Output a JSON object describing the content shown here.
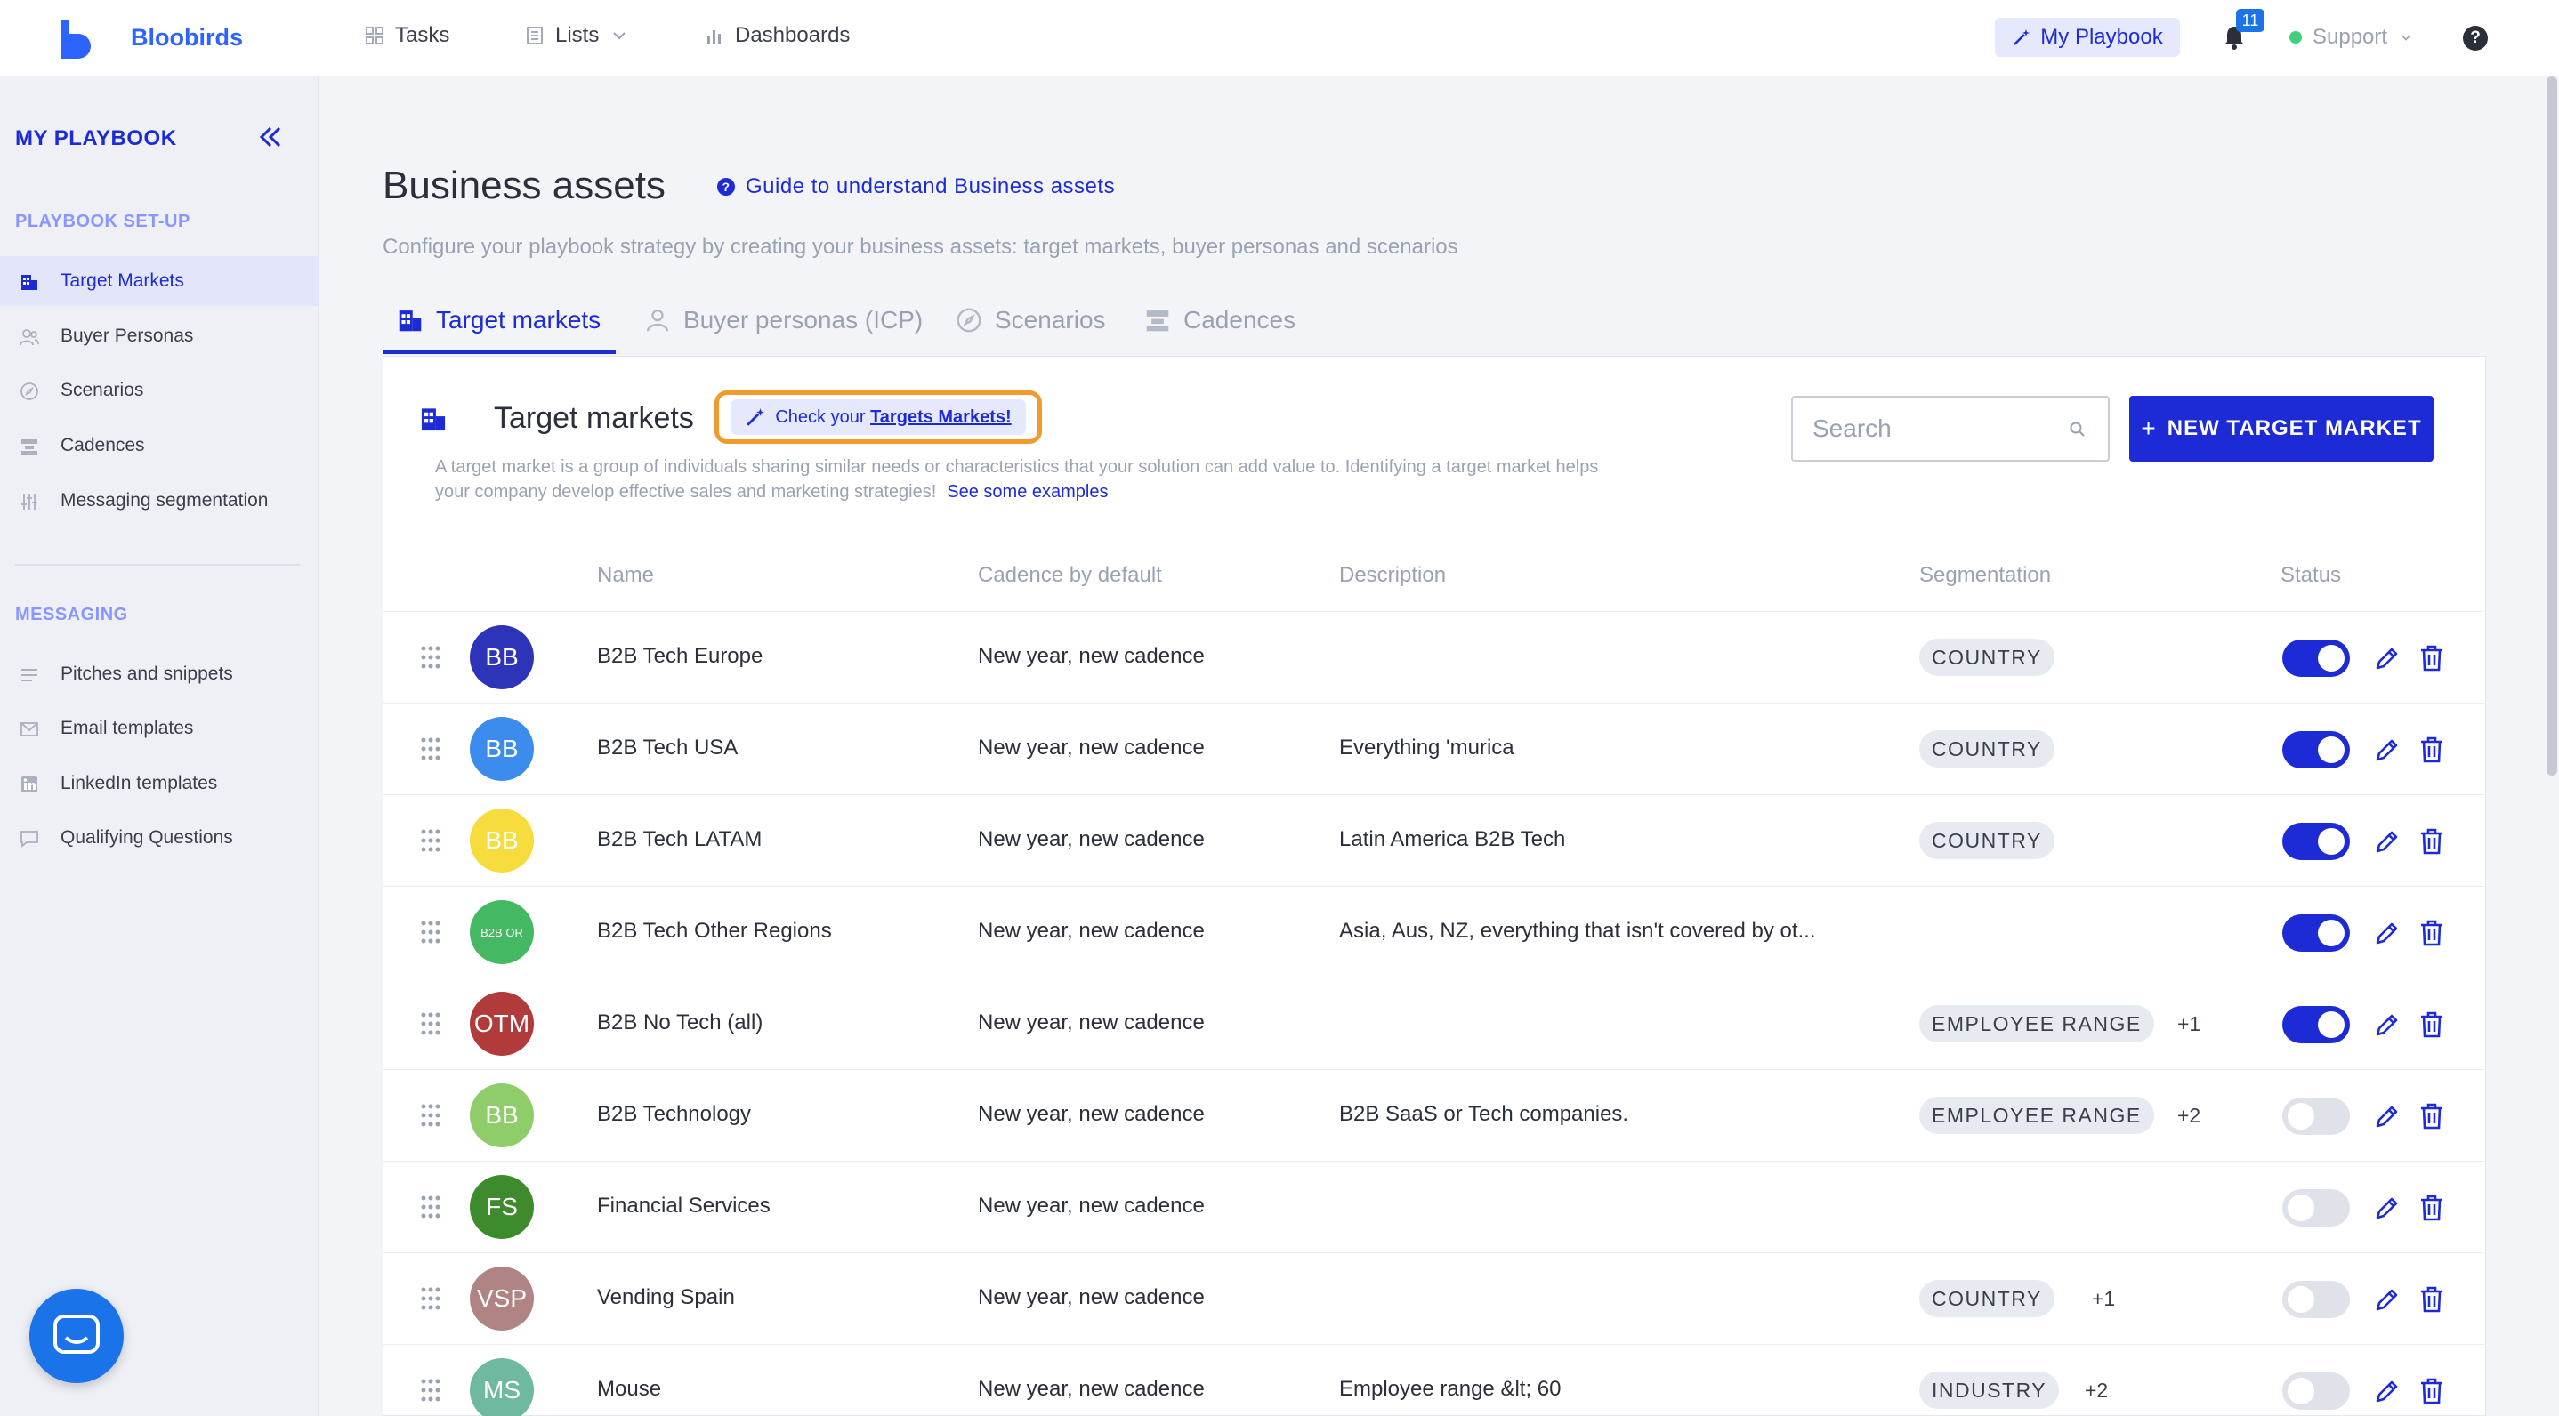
{
  "topbar": {
    "brand": "Bloobirds",
    "nav": [
      {
        "label": "Tasks",
        "icon": "grid-icon"
      },
      {
        "label": "Lists",
        "icon": "list-icon"
      },
      {
        "label": "Dashboards",
        "icon": "bar-chart-icon"
      }
    ],
    "playbook_label": "My Playbook",
    "notifications_count": "11",
    "support_label": "Support",
    "help_label": "?"
  },
  "sidebar": {
    "title": "MY PLAYBOOK",
    "section_setup": "PLAYBOOK SET-UP",
    "setup_items": [
      {
        "label": "Target Markets",
        "icon": "building-icon",
        "active": true
      },
      {
        "label": "Buyer Personas",
        "icon": "people-icon"
      },
      {
        "label": "Scenarios",
        "icon": "compass-icon"
      },
      {
        "label": "Cadences",
        "icon": "cadence-icon"
      },
      {
        "label": "Messaging segmentation",
        "icon": "sliders-icon"
      }
    ],
    "section_messaging": "MESSAGING",
    "messaging_items": [
      {
        "label": "Pitches and snippets",
        "icon": "lines-icon"
      },
      {
        "label": "Email templates",
        "icon": "envelope-icon"
      },
      {
        "label": "LinkedIn templates",
        "icon": "linkedin-icon"
      },
      {
        "label": "Qualifying Questions",
        "icon": "chat-icon"
      }
    ]
  },
  "main": {
    "title": "Business assets",
    "guide_link": "Guide to understand Business assets",
    "subtitle": "Configure your playbook strategy by creating your business assets: target markets, buyer personas and scenarios",
    "tabs": [
      {
        "label": "Target markets",
        "icon": "building-icon",
        "active": true
      },
      {
        "label": "Buyer personas (ICP)",
        "icon": "person-icon"
      },
      {
        "label": "Scenarios",
        "icon": "compass-icon"
      },
      {
        "label": "Cadences",
        "icon": "cadence-icon"
      }
    ]
  },
  "card": {
    "title": "Target markets",
    "check_prefix": "Check your ",
    "check_link": "Targets Markets!",
    "description_1": "A target market is a group of individuals sharing similar needs or characteristics that your solution can add value to. Identifying a target market helps",
    "description_2": "your company develop effective sales and marketing strategies!",
    "examples_link": "See some examples",
    "search_placeholder": "Search",
    "new_button": "NEW TARGET MARKET",
    "headers": {
      "name": "Name",
      "cadence": "Cadence by default",
      "description": "Description",
      "segmentation": "Segmentation",
      "status": "Status"
    }
  },
  "rows": [
    {
      "initials": "BB",
      "color": "#2e34b8",
      "name": "B2B Tech Europe",
      "cadence": "New year, new cadence",
      "description": "",
      "chip": "COUNTRY",
      "more": "",
      "active": true
    },
    {
      "initials": "BB",
      "color": "#3b8ced",
      "name": "B2B Tech USA",
      "cadence": "New year, new cadence",
      "description": "Everything 'murica",
      "chip": "COUNTRY",
      "more": "",
      "active": true
    },
    {
      "initials": "BB",
      "color": "#f6dc3c",
      "name": "B2B Tech LATAM",
      "cadence": "New year, new cadence",
      "description": "Latin America B2B Tech",
      "chip": "COUNTRY",
      "more": "",
      "active": true
    },
    {
      "initials": "B2B OR",
      "color": "#45b864",
      "name": "B2B Tech Other Regions",
      "cadence": "New year, new cadence",
      "description": "Asia, Aus, NZ, everything that isn't covered by ot...",
      "chip": "",
      "more": "",
      "active": true
    },
    {
      "initials": "OTM",
      "color": "#b13b3b",
      "name": "B2B No Tech (all)",
      "cadence": "New year, new cadence",
      "description": "",
      "chip": "EMPLOYEE RANGE",
      "more": "+1",
      "active": true
    },
    {
      "initials": "BB",
      "color": "#8fcc6a",
      "name": "B2B Technology",
      "cadence": "New year, new cadence",
      "description": "B2B SaaS or Tech companies.",
      "chip": "EMPLOYEE RANGE",
      "more": "+2",
      "active": false
    },
    {
      "initials": "FS",
      "color": "#3d8b2c",
      "name": "Financial Services",
      "cadence": "New year, new cadence",
      "description": "",
      "chip": "",
      "more": "",
      "active": false
    },
    {
      "initials": "VSP",
      "color": "#b08484",
      "name": "Vending Spain",
      "cadence": "New year, new cadence",
      "description": "",
      "chip": "COUNTRY",
      "more": "+1",
      "active": false
    },
    {
      "initials": "MS",
      "color": "#6fb9a0",
      "name": "Mouse",
      "cadence": "New year, new cadence",
      "description": "Employee range &lt; 60",
      "chip": "INDUSTRY",
      "more": "+2",
      "active": false
    }
  ]
}
